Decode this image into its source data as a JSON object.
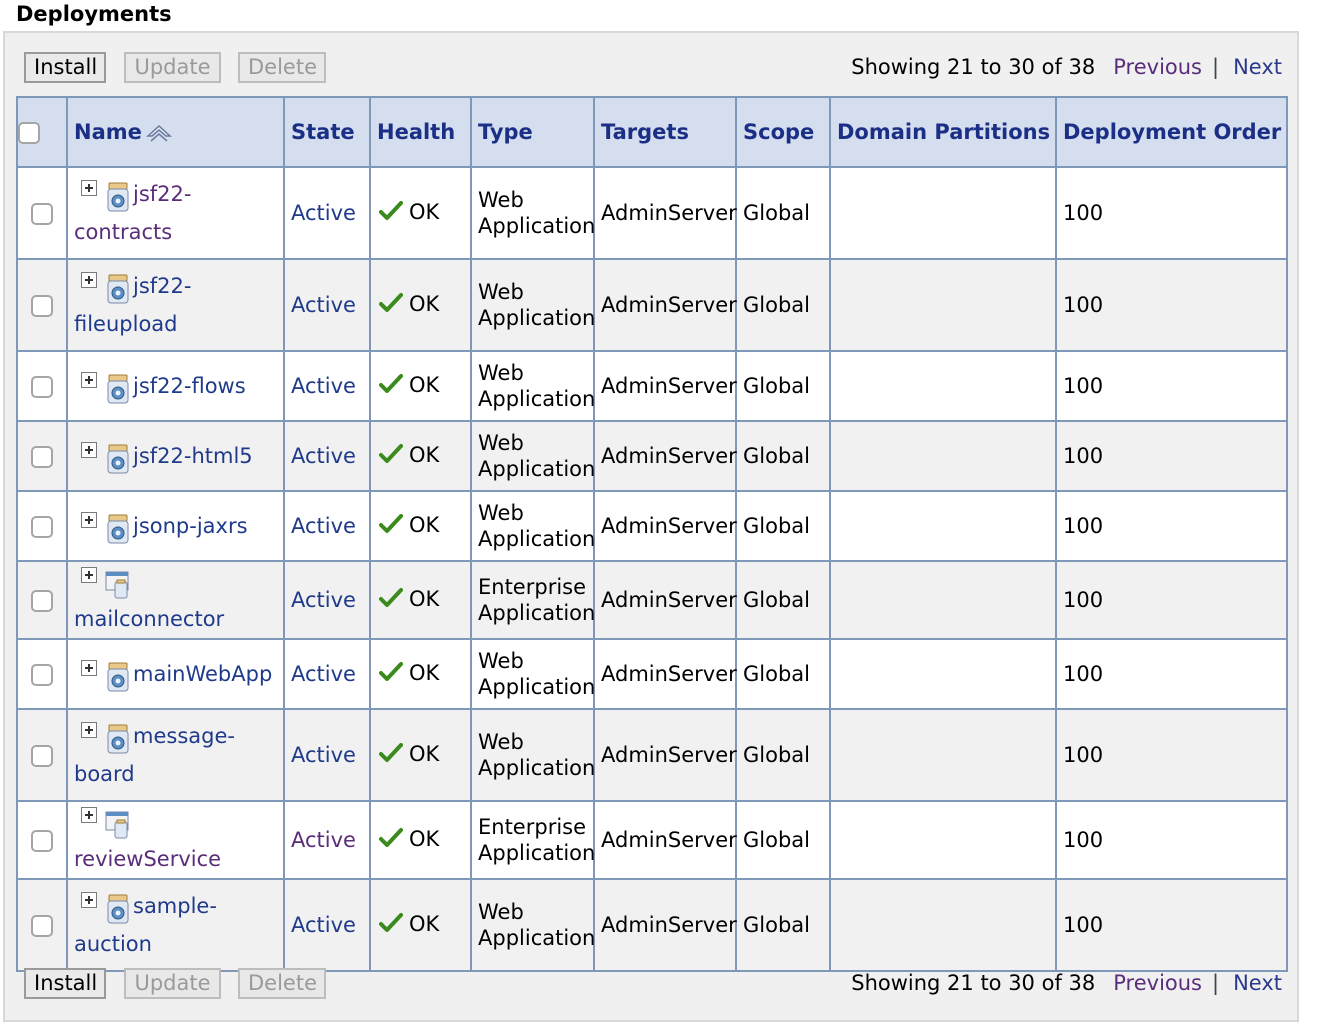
{
  "page_title": "Deployments",
  "toolbar": {
    "install_label": "Install",
    "update_label": "Update",
    "delete_label": "Delete",
    "showing_text": "Showing 21 to 30 of 38",
    "previous_label": "Previous",
    "separator": "|",
    "next_label": "Next"
  },
  "columns": {
    "name": "Name",
    "state": "State",
    "health": "Health",
    "type": "Type",
    "targets": "Targets",
    "scope": "Scope",
    "domain_partitions": "Domain Partitions",
    "deployment_order": "Deployment Order"
  },
  "rows": [
    {
      "name_line1": "jsf22-",
      "name_line2": "contracts",
      "icon": "web-app-icon",
      "name_visited": true,
      "state": "Active",
      "state_visited": false,
      "health": "OK",
      "type_line1": "Web",
      "type_line2": "Application",
      "targets": "AdminServer",
      "scope": "Global",
      "domain_partitions": "",
      "deployment_order": "100"
    },
    {
      "name_line1": "jsf22-",
      "name_line2": "fileupload",
      "icon": "web-app-icon",
      "name_visited": false,
      "state": "Active",
      "state_visited": false,
      "health": "OK",
      "type_line1": "Web",
      "type_line2": "Application",
      "targets": "AdminServer",
      "scope": "Global",
      "domain_partitions": "",
      "deployment_order": "100"
    },
    {
      "name_line1": "jsf22-flows",
      "name_line2": "",
      "icon": "web-app-icon",
      "name_visited": false,
      "state": "Active",
      "state_visited": false,
      "health": "OK",
      "type_line1": "Web",
      "type_line2": "Application",
      "targets": "AdminServer",
      "scope": "Global",
      "domain_partitions": "",
      "deployment_order": "100"
    },
    {
      "name_line1": "jsf22-html5",
      "name_line2": "",
      "icon": "web-app-icon",
      "name_visited": false,
      "state": "Active",
      "state_visited": false,
      "health": "OK",
      "type_line1": "Web",
      "type_line2": "Application",
      "targets": "AdminServer",
      "scope": "Global",
      "domain_partitions": "",
      "deployment_order": "100"
    },
    {
      "name_line1": "jsonp-jaxrs",
      "name_line2": "",
      "icon": "web-app-icon",
      "name_visited": false,
      "state": "Active",
      "state_visited": false,
      "health": "OK",
      "type_line1": "Web",
      "type_line2": "Application",
      "targets": "AdminServer",
      "scope": "Global",
      "domain_partitions": "",
      "deployment_order": "100"
    },
    {
      "name_line1": "mailconnector",
      "name_line2": "",
      "icon": "enterprise-app-icon",
      "name_visited": false,
      "state": "Active",
      "state_visited": false,
      "health": "OK",
      "type_line1": "Enterprise",
      "type_line2": "Application",
      "targets": "AdminServer",
      "scope": "Global",
      "domain_partitions": "",
      "deployment_order": "100"
    },
    {
      "name_line1": "mainWebApp",
      "name_line2": "",
      "icon": "web-app-icon",
      "name_visited": false,
      "state": "Active",
      "state_visited": false,
      "health": "OK",
      "type_line1": "Web",
      "type_line2": "Application",
      "targets": "AdminServer",
      "scope": "Global",
      "domain_partitions": "",
      "deployment_order": "100"
    },
    {
      "name_line1": "message-",
      "name_line2": "board",
      "icon": "web-app-icon",
      "name_visited": false,
      "state": "Active",
      "state_visited": false,
      "health": "OK",
      "type_line1": "Web",
      "type_line2": "Application",
      "targets": "AdminServer",
      "scope": "Global",
      "domain_partitions": "",
      "deployment_order": "100"
    },
    {
      "name_line1": "reviewService",
      "name_line2": "",
      "icon": "enterprise-app-icon",
      "name_visited": true,
      "state": "Active",
      "state_visited": true,
      "health": "OK",
      "type_line1": "Enterprise",
      "type_line2": "Application",
      "targets": "AdminServer",
      "scope": "Global",
      "domain_partitions": "",
      "deployment_order": "100"
    },
    {
      "name_line1": "sample-",
      "name_line2": "auction",
      "icon": "web-app-icon",
      "name_visited": false,
      "state": "Active",
      "state_visited": false,
      "health": "OK",
      "type_line1": "Web",
      "type_line2": "Application",
      "targets": "AdminServer",
      "scope": "Global",
      "domain_partitions": "",
      "deployment_order": "100"
    }
  ],
  "colors": {
    "header_bg": "#d5deee",
    "header_text": "#1a2f85",
    "link": "#1f3a8a",
    "visited_link": "#5a2d7a",
    "border": "#7f97b8",
    "ok_check": "#3a8a1e"
  }
}
